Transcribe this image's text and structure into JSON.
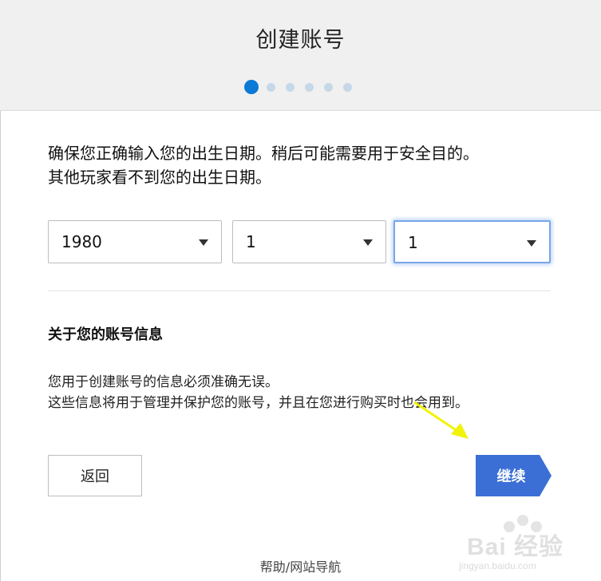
{
  "header": {
    "title": "创建账号",
    "steps": {
      "total": 6,
      "current": 1
    }
  },
  "intro": {
    "line1": "确保您正确输入您的出生日期。稍后可能需要用于安全目的。",
    "line2": "其他玩家看不到您的出生日期。"
  },
  "birthdate": {
    "year": "1980",
    "month": "1",
    "day": "1"
  },
  "account_info": {
    "heading": "关于您的账号信息",
    "line1": "您用于创建账号的信息必须准确无误。",
    "line2": "这些信息将用于管理并保护您的账号，并且在您进行购买时也会用到。"
  },
  "buttons": {
    "back": "返回",
    "next": "继续"
  },
  "footer": {
    "help_link": "帮助/网站导航"
  },
  "watermark": {
    "brand": "Bai 经验",
    "site": "jingyan.baidu.com"
  },
  "colors": {
    "accent": "#0b79d6",
    "next_button": "#3b6fd6",
    "annotation_arrow": "#f2f20a"
  }
}
